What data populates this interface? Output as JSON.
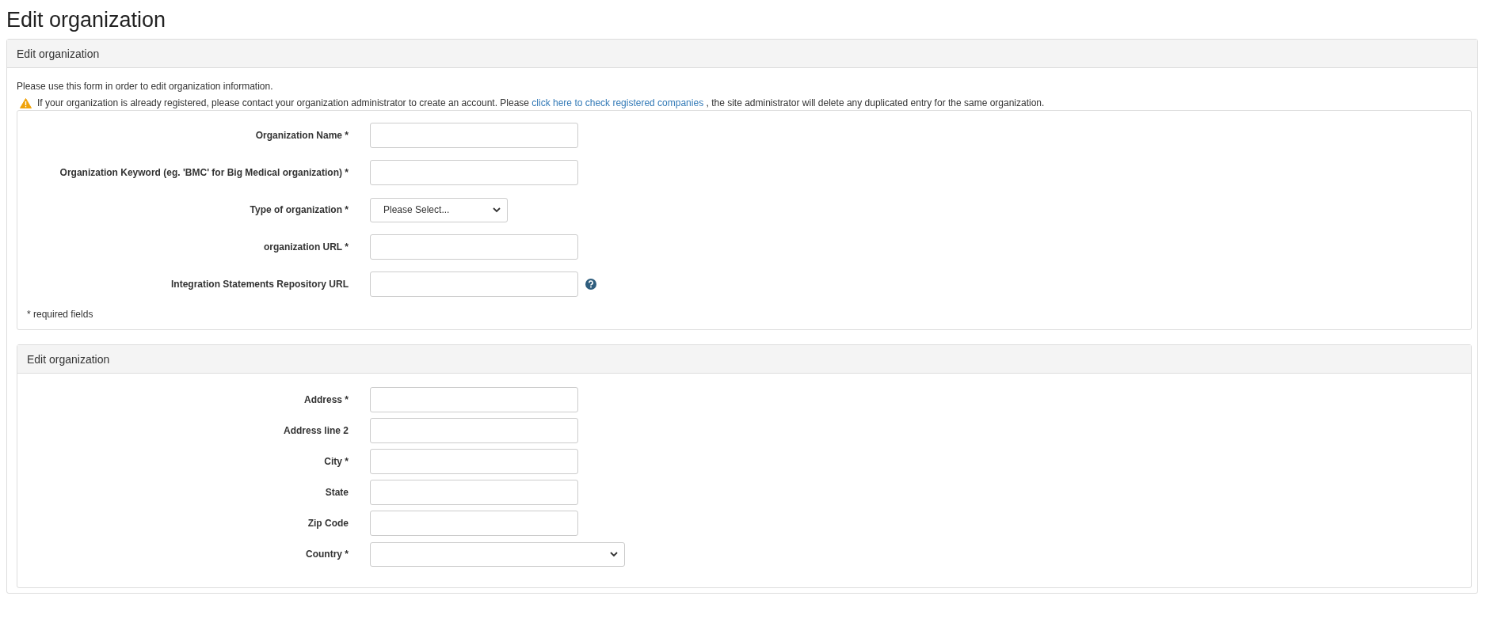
{
  "page_title": "Edit organization",
  "panel": {
    "title": "Edit organization",
    "intro": "Please use this form in order to edit organization information.",
    "warning": {
      "before": "If your organization is already registered, please contact your organization administrator to create an account. Please",
      "link": "click here to check registered companies",
      "after": ", the site administrator will delete any duplicated entry for the same organization."
    },
    "fields": [
      {
        "kind": "text",
        "label": "Organization Name *"
      },
      {
        "kind": "text",
        "label": "Organization Keyword (eg. 'BMC' for Big Medical organization) *"
      },
      {
        "kind": "select",
        "label": "Type of organization *",
        "value": "Please Select..."
      },
      {
        "kind": "text",
        "label": "organization URL *"
      },
      {
        "kind": "text",
        "label": "Integration Statements Repository URL",
        "help": true
      }
    ],
    "note": "* required fields"
  },
  "address_panel": {
    "title": "Edit organization",
    "fields": [
      {
        "kind": "text",
        "label": "Address *"
      },
      {
        "kind": "text",
        "label": "Address line 2"
      },
      {
        "kind": "text",
        "label": "City *"
      },
      {
        "kind": "text",
        "label": "State"
      },
      {
        "kind": "text",
        "label": "Zip Code"
      },
      {
        "kind": "wide_select",
        "label": "Country *"
      }
    ]
  }
}
